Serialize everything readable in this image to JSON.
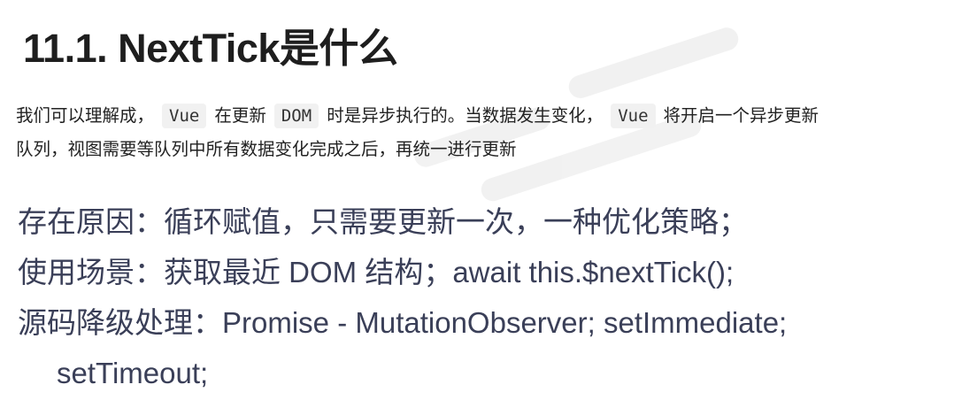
{
  "heading": "11.1. NextTick是什么",
  "intro": {
    "line1_a": "我们可以理解成，",
    "line1_code1": "Vue",
    "line1_b": "在更新",
    "line1_code2": "DOM",
    "line1_c": "时是异步执行的。当数据发生变化，",
    "line1_code3": "Vue",
    "line1_d": "将开启一个异步更新",
    "line2": "队列，视图需要等队列中所有数据变化完成之后，再统一进行更新"
  },
  "notes": {
    "line1": "存在原因：循环赋值，只需要更新一次，一种优化策略；",
    "line2": "使用场景：获取最近 DOM 结构；await this.$nextTick();",
    "line3": "源码降级处理：Promise - MutationObserver; setImmediate;",
    "line4": "setTimeout;"
  }
}
